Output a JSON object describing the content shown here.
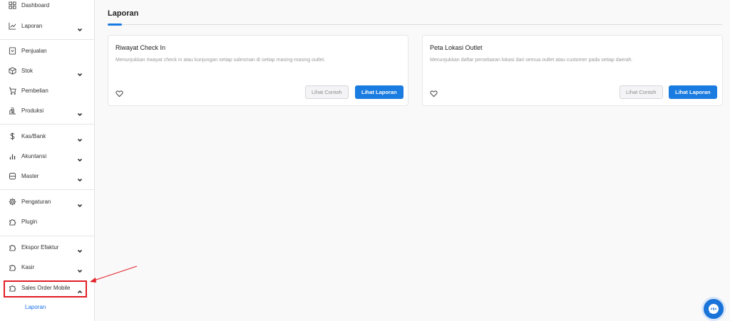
{
  "sidebar": {
    "items": [
      {
        "label": "Dashboard",
        "icon": "grid-icon"
      },
      {
        "label": "Laporan",
        "icon": "chart-line-icon",
        "chevron": "down"
      },
      {
        "label": "Penjualan",
        "icon": "receipt-icon"
      },
      {
        "label": "Stok",
        "icon": "box-icon",
        "chevron": "down"
      },
      {
        "label": "Pembelian",
        "icon": "cart-icon"
      },
      {
        "label": "Produksi",
        "icon": "factory-icon",
        "chevron": "down"
      },
      {
        "label": "Kas/Bank",
        "icon": "dollar-icon",
        "chevron": "down"
      },
      {
        "label": "Akuntansi",
        "icon": "bar-chart-icon",
        "chevron": "down"
      },
      {
        "label": "Master",
        "icon": "database-icon",
        "chevron": "down"
      },
      {
        "label": "Pengaturan",
        "icon": "gear-icon",
        "chevron": "down"
      },
      {
        "label": "Plugin",
        "icon": "puzzle-icon"
      },
      {
        "label": "Ekspor Efaktur",
        "icon": "puzzle-icon",
        "chevron": "down"
      },
      {
        "label": "Kasir",
        "icon": "puzzle-icon",
        "chevron": "down"
      },
      {
        "label": "Sales Order Mobile",
        "icon": "puzzle-icon",
        "chevron": "up"
      }
    ],
    "sub_item": "Laporan"
  },
  "main": {
    "title": "Laporan",
    "cards": [
      {
        "title": "Riwayat Check In",
        "description": "Menunjukkan riwayat check in atau kunjungan setiap salesman di setiap masing-masing outlet.",
        "sample_button": "Lihat Contoh",
        "view_button": "Lihat Laporan"
      },
      {
        "title": "Peta Lokasi Outlet",
        "description": "Menunjukkan daftar persebaran lokasi dari semua outlet atau customer pada setiap daerah.",
        "sample_button": "Lihat Contoh",
        "view_button": "Lihat Laporan"
      }
    ]
  },
  "colors": {
    "accent": "#1a7be0",
    "annotation": "#e21e26",
    "link": "#1a73e8"
  }
}
